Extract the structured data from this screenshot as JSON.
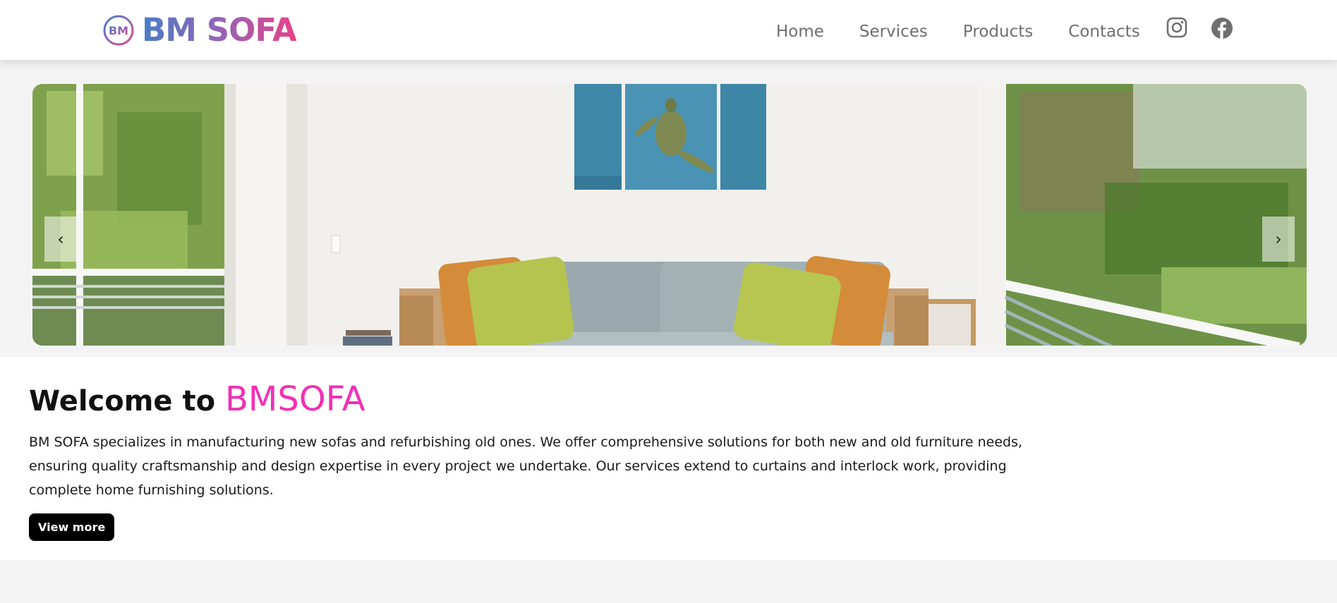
{
  "brand": {
    "logo_mark_text": "BM",
    "name": "BM SOFA",
    "gradient_colors": [
      "#4a7cc7",
      "#8b68b7",
      "#e8418a"
    ]
  },
  "nav": {
    "items": [
      {
        "label": "Home"
      },
      {
        "label": "Services"
      },
      {
        "label": "Products"
      },
      {
        "label": "Contacts"
      }
    ],
    "social": [
      {
        "icon": "instagram-icon"
      },
      {
        "icon": "facebook-icon"
      }
    ]
  },
  "hero": {
    "prev_label": "‹",
    "next_label": "›"
  },
  "welcome": {
    "heading_prefix": "Welcome to",
    "heading_brand": "BMSOFA",
    "brand_color": "#f12fb5",
    "body": "BM SOFA specializes in manufacturing new sofas and refurbishing old ones. We offer comprehensive solutions for both new and old furniture needs, ensuring quality craftsmanship and design expertise in every project we undertake. Our services extend to curtains and interlock work, providing complete home furnishing solutions.",
    "button_label": "View more"
  }
}
